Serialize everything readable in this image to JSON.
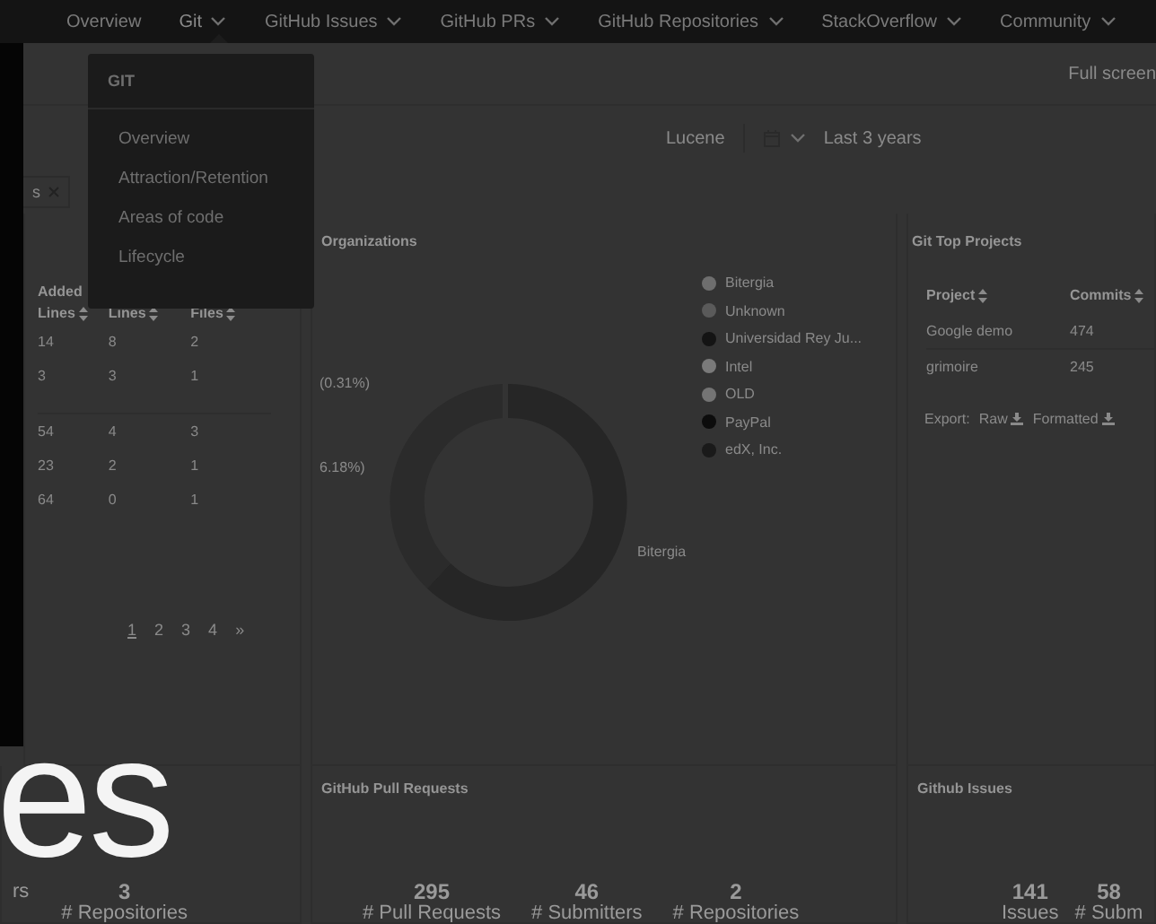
{
  "nav": {
    "items": [
      {
        "label": "Overview",
        "dropdown": false,
        "selected": false
      },
      {
        "label": "Git",
        "dropdown": true,
        "selected": true
      },
      {
        "label": "GitHub Issues",
        "dropdown": true,
        "selected": false
      },
      {
        "label": "GitHub PRs",
        "dropdown": true,
        "selected": false
      },
      {
        "label": "GitHub Repositories",
        "dropdown": true,
        "selected": false
      },
      {
        "label": "StackOverflow",
        "dropdown": true,
        "selected": false
      },
      {
        "label": "Community",
        "dropdown": true,
        "selected": false
      }
    ]
  },
  "dropdown": {
    "title": "GIT",
    "items": [
      "Overview",
      "Attraction/Retention",
      "Areas of code",
      "Lifecycle"
    ]
  },
  "full_screen": "Full screen",
  "filters": {
    "project": "Lucene",
    "range": "Last 3 years"
  },
  "filter_chip": {
    "label": "s"
  },
  "commits_table": {
    "columns": [
      {
        "top": "Added",
        "label": "Lines"
      },
      {
        "label": "Lines"
      },
      {
        "label": "Files"
      }
    ],
    "row_groups": [
      [
        [
          "14",
          "8",
          "2"
        ],
        [
          "3",
          "3",
          "1"
        ]
      ],
      [
        [
          "54",
          "4",
          "3"
        ],
        [
          "23",
          "2",
          "1"
        ],
        [
          "64",
          "0",
          "1"
        ]
      ]
    ],
    "pagination": {
      "pages": [
        {
          "label": "1",
          "selected": true
        },
        {
          "label": "2",
          "selected": false
        },
        {
          "label": "3",
          "selected": false
        },
        {
          "label": "4",
          "selected": false
        }
      ],
      "next": "»"
    }
  },
  "organizations": {
    "title": "Organizations",
    "percent_labels": [
      "(0.31%)",
      "6.18%)"
    ],
    "slice_label": "Bitergia",
    "legend": [
      {
        "name": "Bitergia",
        "color": "#6e6e6e"
      },
      {
        "name": "Unknown",
        "color": "#5a5a5a"
      },
      {
        "name": "Universidad Rey Ju...",
        "color": "#141414"
      },
      {
        "name": "Intel",
        "color": "#7a7a7a"
      },
      {
        "name": "OLD",
        "color": "#747474"
      },
      {
        "name": "PayPal",
        "color": "#0c0c0c"
      },
      {
        "name": "edX, Inc.",
        "color": "#1a1a1a"
      }
    ]
  },
  "top_projects": {
    "title": "Git Top Projects",
    "columns": [
      "Project",
      "Commits"
    ],
    "rows": [
      [
        "Google demo",
        "474"
      ],
      [
        "grimoire",
        "245"
      ]
    ],
    "export": {
      "label": "Export:",
      "links": [
        "Raw",
        "Formatted"
      ]
    }
  },
  "left_stats": [
    {
      "label": "rs"
    },
    {
      "value": "3",
      "label": "# Repositories"
    }
  ],
  "pull_requests": {
    "title": "GitHub Pull Requests",
    "stats": [
      {
        "value": "295",
        "label": "# Pull Requests"
      },
      {
        "value": "46",
        "label": "# Submitters"
      },
      {
        "value": "2",
        "label": "# Repositories"
      }
    ]
  },
  "issues": {
    "title": "Github Issues",
    "stats": [
      {
        "value": "141",
        "label": "Issues"
      },
      {
        "value": "58",
        "label": "# Subm"
      }
    ]
  },
  "caption": "es"
}
